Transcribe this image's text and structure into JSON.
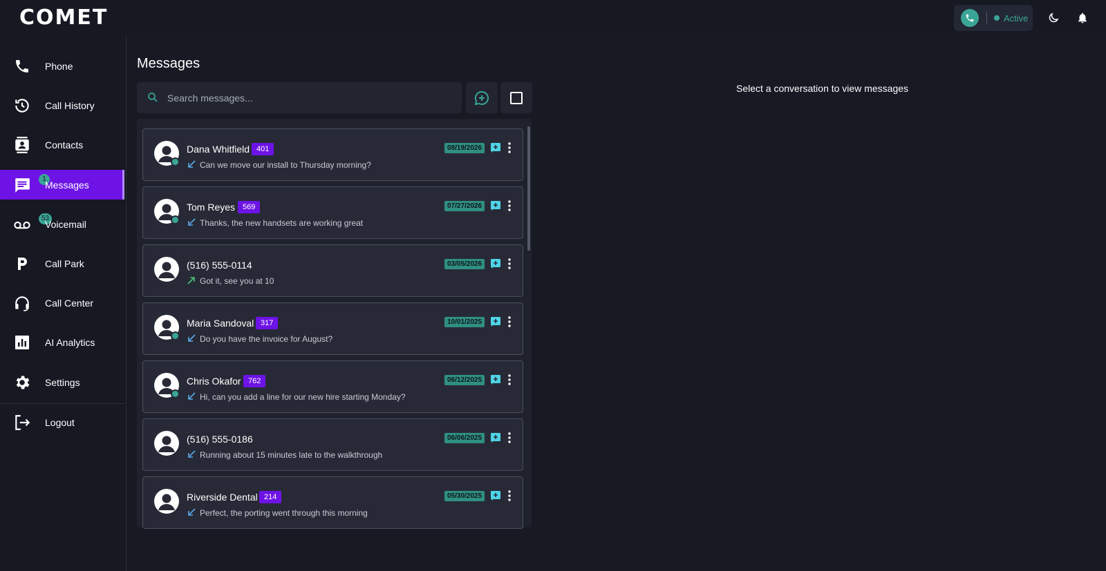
{
  "app": {
    "logo_text": "COMET"
  },
  "header": {
    "status_label": "Active",
    "icons": [
      "phone-icon",
      "moon-icon",
      "bell-icon"
    ]
  },
  "sidebar": {
    "items": [
      {
        "label": "Phone",
        "icon": "phone-icon"
      },
      {
        "label": "Call History",
        "icon": "history-icon"
      },
      {
        "label": "Contacts",
        "icon": "contacts-icon"
      },
      {
        "label": "Messages",
        "icon": "message-icon",
        "badge": "1",
        "active": true
      },
      {
        "label": "Voicemail",
        "icon": "voicemail-icon",
        "badge": "53"
      },
      {
        "label": "Call Park",
        "icon": "park-icon"
      },
      {
        "label": "Call Center",
        "icon": "headset-icon"
      },
      {
        "label": "AI Analytics",
        "icon": "analytics-icon"
      },
      {
        "label": "Settings",
        "icon": "gear-icon"
      },
      {
        "label": "Logout",
        "icon": "logout-icon"
      }
    ]
  },
  "main": {
    "title": "Messages",
    "search": {
      "placeholder": "Search messages...",
      "value": ""
    },
    "empty_state": "Select a conversation to view messages"
  },
  "conversations": [
    {
      "name": "Dana Whitfield",
      "ext": "401",
      "date": "08/19/2026",
      "preview": "Can we move our install to Thursday morning?",
      "direction": "incoming",
      "online": true
    },
    {
      "name": "Tom Reyes",
      "ext": "569",
      "date": "07/27/2026",
      "preview": "Thanks, the new handsets are working great",
      "direction": "incoming",
      "online": true
    },
    {
      "name": "(516) 555-0114",
      "ext": "",
      "date": "03/05/2026",
      "preview": "Got it, see you at 10",
      "direction": "outgoing",
      "online": false
    },
    {
      "name": "Maria Sandoval",
      "ext": "317",
      "date": "10/01/2025",
      "preview": "Do you have the invoice for August?",
      "direction": "incoming",
      "online": true
    },
    {
      "name": "Chris Okafor",
      "ext": "762",
      "date": "06/12/2025",
      "preview": "Hi, can you add a line for our new hire starting Monday?",
      "direction": "incoming",
      "online": true
    },
    {
      "name": "(516) 555-0186",
      "ext": "",
      "date": "06/06/2025",
      "preview": "Running about 15 minutes late to the walkthrough",
      "direction": "incoming",
      "online": false
    },
    {
      "name": "Riverside Dental",
      "ext": "214",
      "date": "05/30/2025",
      "preview": "Perfect, the porting went through this morning",
      "direction": "incoming",
      "online": false
    }
  ],
  "colors": {
    "accent": "#6d13e6",
    "teal": "#3aa597",
    "incoming_arrow": "#5aa8e8",
    "outgoing_arrow": "#4cc27a"
  }
}
